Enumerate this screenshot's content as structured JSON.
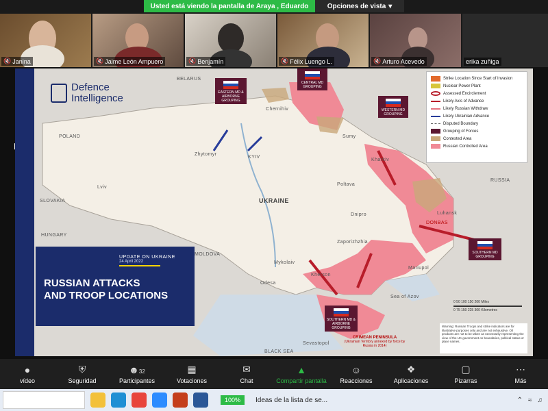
{
  "share_banner": {
    "viewing": "Usted está viendo la pantalla de Araya , Eduardo",
    "options": "Opciones de vista",
    "options_chevron": "chevron-down-icon"
  },
  "participants": [
    {
      "name": "Janina"
    },
    {
      "name": "Jaime León Ampuero"
    },
    {
      "name": "Benjamín"
    },
    {
      "name": "Félix Luengo L."
    },
    {
      "name": "Arturo Acevedo"
    },
    {
      "name": "erika zuñiga"
    }
  ],
  "map": {
    "logo": {
      "line1": "Defence",
      "line2": "Intelligence"
    },
    "title_box": {
      "kicker": "UPDATE ON UKRAINE",
      "date": "24 April 2022",
      "title_line1": "RUSSIAN ATTACKS",
      "title_line2": "AND TROOP LOCATIONS"
    },
    "legend": [
      {
        "label": "Strike Location Since Start of Invasion"
      },
      {
        "label": "Nuclear Power Plant"
      },
      {
        "label": "Assessed Encirclement"
      },
      {
        "label": "Likely Axis of Advance"
      },
      {
        "label": "Likely Russian Withdraw"
      },
      {
        "label": "Likely Ukrainian Advance"
      },
      {
        "label": "Disputed Boundary"
      },
      {
        "label": "Grouping of Forces"
      },
      {
        "label": "Contested Area"
      },
      {
        "label": "Russian Controlled Area"
      }
    ],
    "countries": {
      "belarus": "BELARUS",
      "russia": "RUSSIA",
      "poland": "POLAND",
      "slovakia": "SLOVAKIA",
      "hungary": "HUNGARY",
      "moldova": "MOLDOVA",
      "ukraine": "UKRAINE",
      "black_sea": "BLACK SEA",
      "sea_of_azov": "Sea of Azov"
    },
    "cities": {
      "kyiv": "KYIV",
      "lviv": "Lviv",
      "kharkiv": "Kharkiv",
      "odesa": "Odesa",
      "mariupol": "Mariupol",
      "kherson": "Kherson",
      "zaporizhzhia": "Zaporizhzhia",
      "sevastopol": "Sevastopol",
      "luhansk": "Luhansk",
      "donetsk": "DONBAS",
      "mykolaiv": "Mykolaiv",
      "dnipro": "Dnipro",
      "chernihiv": "Chernihiv",
      "sumy": "Sumy",
      "poltava": "Poltava",
      "zhytomyr": "Zhytomyr"
    },
    "groupings": {
      "eastern": "EASTERN MD & AIRBORNE GROUPING",
      "central": "CENTRAL MD GROUPING",
      "western": "WESTERN MD GROUPING",
      "southern": "SOUTHERN MD GROUPING",
      "southern_air": "SOUTHERN MD & AIRBORNE GROUPING"
    },
    "crimea": {
      "title": "CRIMEAN PENINSULA",
      "sub": "(Ukrainian Territory annexed by force by Russia in 2014)"
    },
    "warning": "Warning: Russian Troops and strike indicators are for illustrative purposes only and are not exhaustive. Oil products are not to be taken as necessarily representing the view of the UK government on boundaries, political status or place names.",
    "scale": {
      "miles": "0   50   100   150   200 Miles",
      "km": "0     75    150   225   300 Kilometres"
    }
  },
  "toolbar": [
    {
      "label": "vídeo",
      "icon": "video-icon"
    },
    {
      "label": "Seguridad",
      "icon": "shield-icon"
    },
    {
      "label": "Participantes",
      "icon": "participants-icon",
      "count": "32"
    },
    {
      "label": "Votaciones",
      "icon": "polls-icon"
    },
    {
      "label": "Chat",
      "icon": "chat-icon"
    },
    {
      "label": "Compartir pantalla",
      "icon": "share-screen-icon"
    },
    {
      "label": "Reacciones",
      "icon": "reactions-icon"
    },
    {
      "label": "Aplicaciones",
      "icon": "apps-icon"
    },
    {
      "label": "Pizarras",
      "icon": "whiteboard-icon"
    },
    {
      "label": "Más",
      "icon": "more-icon"
    }
  ],
  "taskbar": {
    "zoom_percent": "100%",
    "notification": "Ideas de la lista de se...",
    "apps": [
      "file-explorer-icon",
      "edge-icon",
      "chrome-icon",
      "zoom-icon",
      "powerpoint-icon",
      "word-icon"
    ]
  },
  "colors": {
    "share_green": "#2dbb46",
    "navy": "#1b2c6b",
    "russian_red": "#f08a96",
    "grouping": "#5b1731"
  }
}
